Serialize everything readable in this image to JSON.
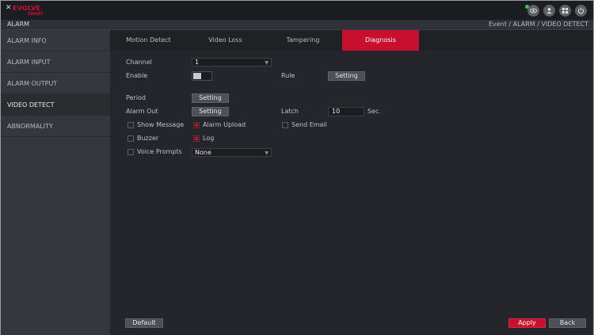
{
  "header": {
    "logo_mark": "✕",
    "logo_brand": "EVOLVE",
    "logo_sub": "SMART",
    "icons": [
      "eye-icon",
      "user-icon",
      "grid-icon",
      "power-icon"
    ],
    "accent": "#c8102e"
  },
  "titlebar": {
    "title": "ALARM",
    "breadcrumb": "Event  /  ALARM  /  VIDEO DETECT"
  },
  "sidebar": {
    "items": [
      {
        "label": "ALARM INFO"
      },
      {
        "label": "ALARM INPUT"
      },
      {
        "label": "ALARM OUTPUT"
      },
      {
        "label": "VIDEO DETECT",
        "active": true
      },
      {
        "label": "ABNORMALITY"
      }
    ]
  },
  "tabs": [
    {
      "label": "Motion Detect"
    },
    {
      "label": "Video Loss"
    },
    {
      "label": "Tampering"
    },
    {
      "label": "Diagnosis",
      "active": true
    }
  ],
  "form": {
    "channel_label": "Channel",
    "channel_value": "1",
    "enable_label": "Enable",
    "enable_on": false,
    "rule_label": "Rule",
    "rule_button": "Setting",
    "period_label": "Period",
    "period_button": "Setting",
    "alarm_out_label": "Alarm Out",
    "alarm_out_button": "Setting",
    "latch_label": "Latch",
    "latch_value": "10",
    "latch_unit": "Sec.",
    "show_message": "Show Message",
    "alarm_upload": "Alarm Upload",
    "send_email": "Send Email",
    "buzzer": "Buzzer",
    "log": "Log",
    "voice_prompts": "Voice Prompts",
    "voice_value": "None"
  },
  "footer": {
    "default_label": "Default",
    "apply_label": "Apply",
    "back_label": "Back"
  }
}
